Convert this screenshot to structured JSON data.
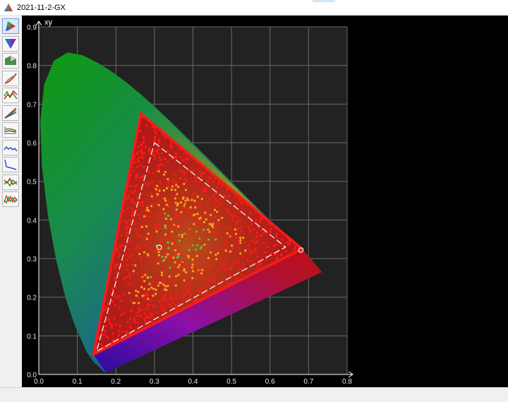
{
  "window": {
    "title": "2021-11-2-GX"
  },
  "toolbar": {
    "tools": [
      {
        "icon": "cie-xy-diagram-icon"
      },
      {
        "icon": "gamut-cone-icon"
      },
      {
        "icon": "gamut-3d-icon"
      },
      {
        "icon": "tone-curve-icon"
      },
      {
        "icon": "spectrum-icon"
      },
      {
        "icon": "rgb-curves-icon"
      },
      {
        "icon": "rgb-balance-icon"
      },
      {
        "icon": "delta-e-icon"
      },
      {
        "icon": "luminance-icon"
      },
      {
        "icon": "gray-balance-icon"
      },
      {
        "icon": "uniformity-icon"
      }
    ],
    "active_index": 0
  },
  "chart_data": {
    "type": "scatter",
    "axis_title": "xy",
    "xlim": [
      0.0,
      0.8
    ],
    "ylim": [
      0.0,
      0.9
    ],
    "xticks": [
      "0.0",
      "0.1",
      "0.2",
      "0.3",
      "0.4",
      "0.5",
      "0.6",
      "0.7",
      "0.8"
    ],
    "yticks": [
      "0.0",
      "0.1",
      "0.2",
      "0.3",
      "0.4",
      "0.5",
      "0.6",
      "0.7",
      "0.8",
      "0.9"
    ],
    "grid": true,
    "background": "#222222",
    "measured_gamut": [
      [
        0.265,
        0.675
      ],
      [
        0.683,
        0.325
      ],
      [
        0.142,
        0.052
      ]
    ],
    "reference_gamut": [
      [
        0.3,
        0.6
      ],
      [
        0.64,
        0.33
      ],
      [
        0.15,
        0.06
      ]
    ],
    "white_points": [
      [
        0.3127,
        0.329
      ],
      [
        0.68,
        0.322
      ]
    ],
    "colors": {
      "measured_points": "#ff1a1a",
      "mid_points": "#ffa020",
      "neutral_points": "#40d040",
      "reference_outline": "#ffffff"
    }
  }
}
